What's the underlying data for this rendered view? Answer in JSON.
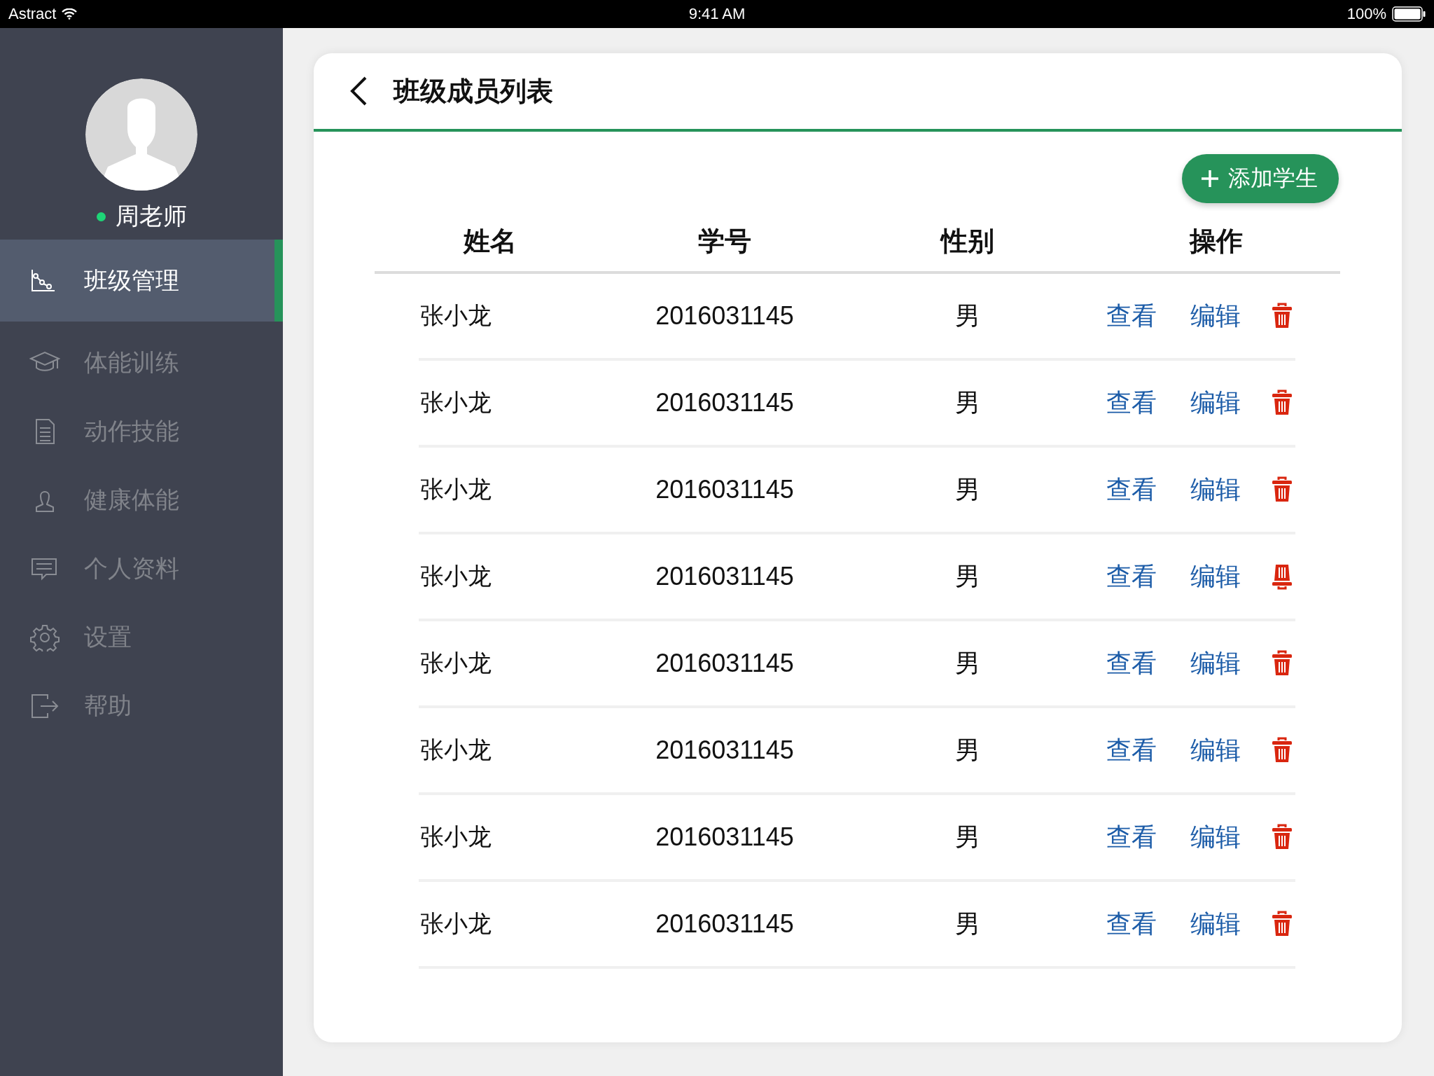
{
  "status_bar": {
    "carrier": "Astract",
    "time": "9:41 AM",
    "battery": "100%"
  },
  "sidebar": {
    "user": {
      "name": "周老师",
      "online": true
    },
    "items": [
      {
        "label": "班级管理",
        "kind": "chart",
        "selected": true
      },
      {
        "label": "体能训练",
        "kind": "cap",
        "selected": false
      },
      {
        "label": "动作技能",
        "kind": "document",
        "selected": false
      },
      {
        "label": "健康体能",
        "kind": "person",
        "selected": false
      },
      {
        "label": "个人资料",
        "kind": "message",
        "selected": false
      },
      {
        "label": "设置",
        "kind": "gear",
        "selected": false
      },
      {
        "label": "帮助",
        "kind": "exit",
        "selected": false
      }
    ]
  },
  "page": {
    "title": "班级成员列表",
    "add_button": "添加学生"
  },
  "table": {
    "columns": [
      "姓名",
      "学号",
      "性别",
      "操作"
    ],
    "rows": [
      {
        "name": "张小龙",
        "student_id": "2016031145",
        "gender": "男",
        "view": "查看",
        "edit": "编辑",
        "delete_icon_inverted": false
      },
      {
        "name": "张小龙",
        "student_id": "2016031145",
        "gender": "男",
        "view": "查看",
        "edit": "编辑",
        "delete_icon_inverted": false
      },
      {
        "name": "张小龙",
        "student_id": "2016031145",
        "gender": "男",
        "view": "查看",
        "edit": "编辑",
        "delete_icon_inverted": false
      },
      {
        "name": "张小龙",
        "student_id": "2016031145",
        "gender": "男",
        "view": "查看",
        "edit": "编辑",
        "delete_icon_inverted": true
      },
      {
        "name": "张小龙",
        "student_id": "2016031145",
        "gender": "男",
        "view": "查看",
        "edit": "编辑",
        "delete_icon_inverted": false
      },
      {
        "name": "张小龙",
        "student_id": "2016031145",
        "gender": "男",
        "view": "查看",
        "edit": "编辑",
        "delete_icon_inverted": false
      },
      {
        "name": "张小龙",
        "student_id": "2016031145",
        "gender": "男",
        "view": "查看",
        "edit": "编辑",
        "delete_icon_inverted": false
      },
      {
        "name": "张小龙",
        "student_id": "2016031145",
        "gender": "男",
        "view": "查看",
        "edit": "编辑",
        "delete_icon_inverted": false
      }
    ]
  }
}
